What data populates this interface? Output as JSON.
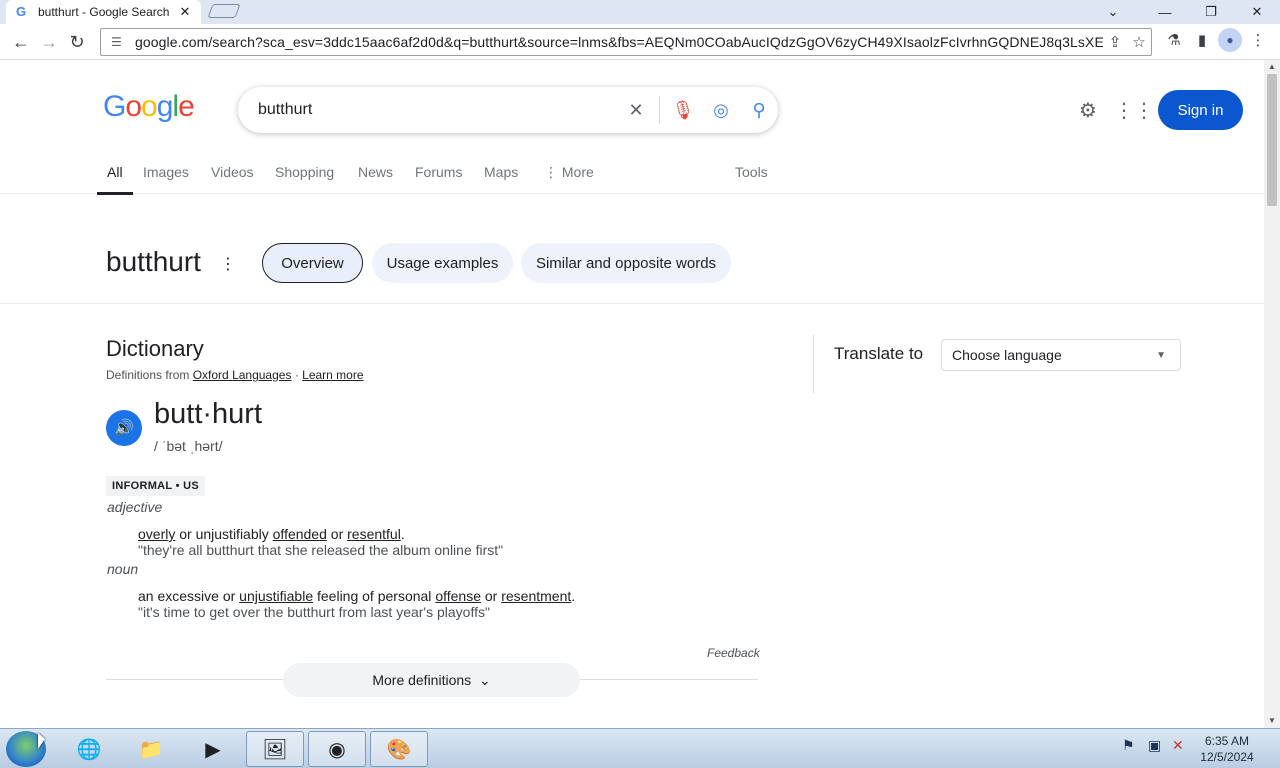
{
  "browser": {
    "tab_title": "butthurt - Google Search",
    "tab_favicon": "G",
    "url": "google.com/search?sca_esv=3ddc15aac6af2d0d&q=butthurt&source=lnms&fbs=AEQNm0COabAucIQdzGgOV6zyCH49XIsaolzFcIvrhnGQDNEJ8q3LsXEAEe..."
  },
  "search": {
    "logo": "Google",
    "query": "butthurt",
    "signin_label": "Sign in",
    "tabs": [
      "All",
      "Images",
      "Videos",
      "Shopping",
      "News",
      "Forums",
      "Maps",
      "More",
      "Tools"
    ]
  },
  "word_header": {
    "word": "butthurt",
    "chips": [
      "Overview",
      "Usage examples",
      "Similar and opposite words"
    ]
  },
  "dictionary": {
    "title": "Dictionary",
    "source_prefix": "Definitions from",
    "source_name": "Oxford Languages",
    "source_sep": "·",
    "learn_more": "Learn more",
    "headword": "butt·hurt",
    "pronunciation": "/ ˈbət ˌhərt/",
    "tag": "INFORMAL • US",
    "entries": [
      {
        "pos": "adjective",
        "parts": [
          "overly",
          " or unjustifiably ",
          "offended",
          " or ",
          "resentful",
          "."
        ],
        "example": "\"they're all butthurt that she released the album online first\""
      },
      {
        "pos": "noun",
        "parts": [
          "an excessive or ",
          "unjustifiable",
          " feeling of personal ",
          "offense",
          " or ",
          "resentment",
          "."
        ],
        "example": "\"it's time to get over the butthurt from last year's playoffs\""
      }
    ],
    "feedback": "Feedback",
    "more_definitions": "More definitions"
  },
  "translate": {
    "label": "Translate to",
    "placeholder": "Choose language"
  },
  "taskbar": {
    "time": "6:35 AM",
    "date": "12/5/2024"
  },
  "colors": {
    "signin_bg": "#0b57d0",
    "speaker_bg": "#1a73e8",
    "chip_bg": "#eef3fb"
  }
}
